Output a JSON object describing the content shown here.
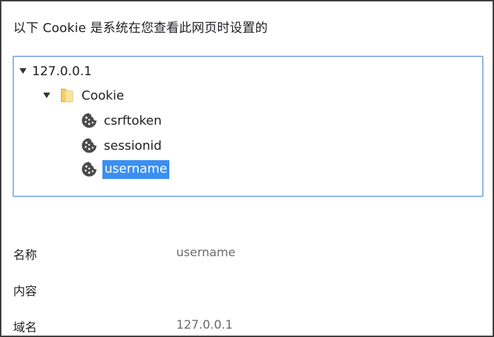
{
  "heading": "以下 Cookie 是系统在您查看此网页时设置的",
  "tree": {
    "host": {
      "label": "127.0.0.1",
      "expanded": true
    },
    "folder": {
      "label": "Cookie",
      "expanded": true
    },
    "cookies": [
      {
        "label": "csrftoken",
        "icon": "cookie-icon",
        "selected": false
      },
      {
        "label": "sessionid",
        "icon": "cookie-icon",
        "selected": false
      },
      {
        "label": "username",
        "icon": "cookie-icon",
        "selected": true
      }
    ]
  },
  "details": {
    "name_key": "名称",
    "name_value": "username",
    "content_key": "内容",
    "content_value": "",
    "domain_key": "域名",
    "domain_value": "127.0.0.1"
  },
  "colors": {
    "selection": "#3b8ff0",
    "tree_border": "#8fb3e6",
    "folder": "#f5cf6a"
  }
}
